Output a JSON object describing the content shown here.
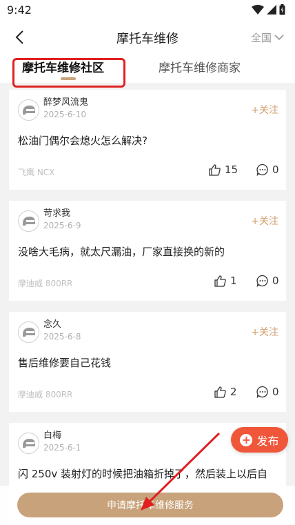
{
  "status_bar": {
    "time": "9:42"
  },
  "header": {
    "title": "摩托车维修",
    "region": "全国"
  },
  "tabs": [
    {
      "label": "摩托车维修社区",
      "active": true
    },
    {
      "label": "摩托车维修商家",
      "active": false
    }
  ],
  "posts": [
    {
      "user": "醉梦风流鬼",
      "date": "2025-6-10",
      "follow": "+关注",
      "content": "松油门偶尔会熄火怎么解决?",
      "tag": "飞鹰 NCX",
      "likes": "15",
      "comments": "0"
    },
    {
      "user": "苛求我",
      "date": "2025-6-9",
      "follow": "+关注",
      "content": "没啥大毛病，就太尺漏油，厂家直接换的新的",
      "tag": "摩迪威 800RR",
      "likes": "1",
      "comments": "0"
    },
    {
      "user": "念久",
      "date": "2025-6-8",
      "follow": "+关注",
      "content": "售后维修要自己花钱",
      "tag": "摩迪威 800RR",
      "likes": "2",
      "comments": "0"
    },
    {
      "user": "白梅",
      "date": "2025-6-1",
      "follow": "+关注",
      "content": "闪 250v 装射灯的时候把油箱折掉了，然后装上以后自",
      "tag": "",
      "likes": "",
      "comments": ""
    }
  ],
  "publish_button": {
    "label": "发布"
  },
  "apply_button": {
    "label": "申请摩托车维修服务"
  },
  "colors": {
    "accent_gold": "#c8a27a",
    "follow_text": "#d4a070",
    "publish_red": "#f0573a",
    "highlight_red": "#e02020"
  },
  "icons": [
    "back-arrow-icon",
    "chevron-down-icon",
    "helmet-avatar-icon",
    "thumbs-up-icon",
    "comment-icon",
    "plus-icon",
    "wifi-icon",
    "signal-icon",
    "battery-icon"
  ]
}
